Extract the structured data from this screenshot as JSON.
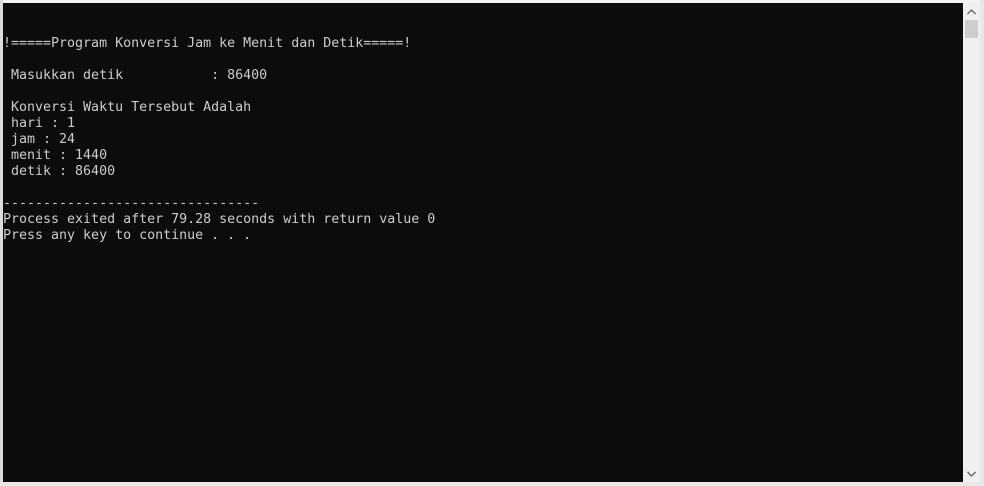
{
  "console": {
    "lines": [
      "",
      "!=====Program Konversi Jam ke Menit dan Detik=====!",
      "",
      " Masukkan detik           : 86400",
      "",
      " Konversi Waktu Tersebut Adalah",
      " hari : 1",
      " jam : 24",
      " menit : 1440",
      " detik : 86400",
      "",
      "--------------------------------",
      "Process exited after 79.28 seconds with return value 0",
      "Press any key to continue . . ."
    ]
  },
  "scrollbar": {
    "up_icon": "chevron-up-icon",
    "down_icon": "chevron-down-icon"
  },
  "colors": {
    "background": "#0c0c0c",
    "text": "#cccccc"
  }
}
